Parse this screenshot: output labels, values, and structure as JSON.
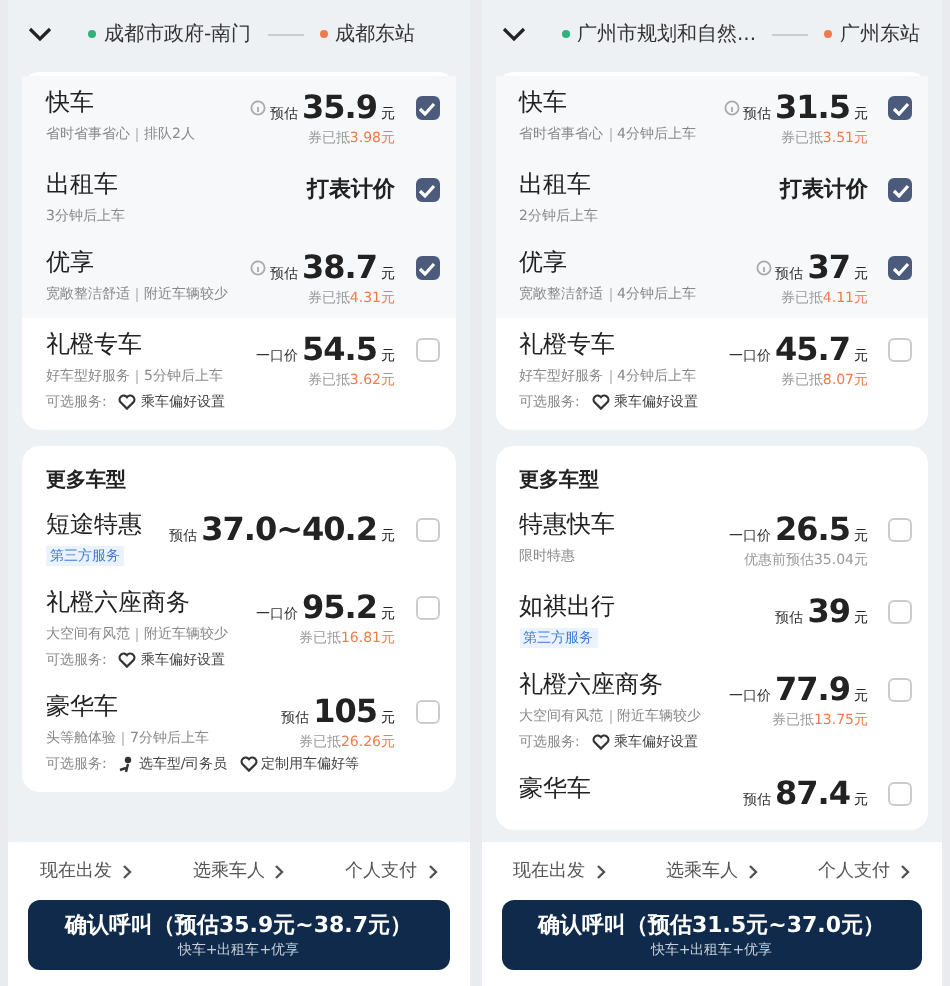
{
  "screens": [
    {
      "from": "成都市政府-南门",
      "to": "成都东站",
      "top_rows": [
        {
          "name": "快车",
          "notes": [
            "省时省事省心",
            "排队2人"
          ],
          "kind": "estimate",
          "prefix": "预估",
          "amount": "35.9",
          "unit": "元",
          "discount": "券已抵",
          "discount_amount": "3.98元",
          "info": true,
          "checked": true
        },
        {
          "name": "出租车",
          "notes": [
            "3分钟后上车"
          ],
          "kind": "meter",
          "meter": "打表计价",
          "checked": true
        },
        {
          "name": "优享",
          "notes": [
            "宽敞整洁舒适",
            "附近车辆较少"
          ],
          "kind": "estimate",
          "prefix": "预估",
          "amount": "38.7",
          "unit": "元",
          "discount": "券已抵",
          "discount_amount": "4.31元",
          "info": true,
          "checked": true
        },
        {
          "name": "礼橙专车",
          "notes": [
            "好车型好服务",
            "5分钟后上车"
          ],
          "kind": "estimate",
          "prefix": "一口价",
          "amount": "54.5",
          "unit": "元",
          "discount": "券已抵",
          "discount_amount": "3.62元",
          "services_label": "可选服务:",
          "services": [
            {
              "kind": "heart",
              "text": "乘车偏好设置"
            }
          ],
          "checked": false
        }
      ],
      "more_title": "更多车型",
      "more_rows": [
        {
          "name": "短途特惠",
          "tag": "第三方服务",
          "kind": "estimate",
          "prefix": "预估",
          "amount": "37.0~40.2",
          "unit": "元",
          "checked": false
        },
        {
          "name": "礼橙六座商务",
          "notes": [
            "大空间有风范",
            "附近车辆较少"
          ],
          "kind": "estimate",
          "prefix": "一口价",
          "amount": "95.2",
          "unit": "元",
          "discount": "券已抵",
          "discount_amount": "16.81元",
          "services_label": "可选服务:",
          "services": [
            {
              "kind": "heart",
              "text": "乘车偏好设置"
            }
          ],
          "checked": false
        },
        {
          "name": "豪华车",
          "notes": [
            "头等舱体验",
            "7分钟后上车"
          ],
          "kind": "estimate",
          "prefix": "预估",
          "amount": "105",
          "unit": "元",
          "discount": "券已抵",
          "discount_amount": "26.26元",
          "services_label": "可选服务:",
          "services": [
            {
              "kind": "person",
              "text": "选车型/司务员"
            },
            {
              "kind": "heart",
              "text": "定制用车偏好等"
            }
          ],
          "checked": false
        }
      ],
      "links": [
        "现在出发",
        "选乘车人",
        "个人支付"
      ],
      "confirm": "确认呼叫（预估35.9元~38.7元）",
      "confirm_sub": "快车+出租车+优享"
    },
    {
      "from": "广州市规划和自然...",
      "to": "广州东站",
      "top_rows": [
        {
          "name": "快车",
          "notes": [
            "省时省事省心",
            "4分钟后上车"
          ],
          "kind": "estimate",
          "prefix": "预估",
          "amount": "31.5",
          "unit": "元",
          "discount": "券已抵",
          "discount_amount": "3.51元",
          "info": true,
          "checked": true
        },
        {
          "name": "出租车",
          "notes": [
            "2分钟后上车"
          ],
          "kind": "meter",
          "meter": "打表计价",
          "checked": true
        },
        {
          "name": "优享",
          "notes": [
            "宽敞整洁舒适",
            "4分钟后上车"
          ],
          "kind": "estimate",
          "prefix": "预估",
          "amount": "37",
          "unit": "元",
          "discount": "券已抵",
          "discount_amount": "4.11元",
          "info": true,
          "checked": true
        },
        {
          "name": "礼橙专车",
          "notes": [
            "好车型好服务",
            "4分钟后上车"
          ],
          "kind": "estimate",
          "prefix": "一口价",
          "amount": "45.7",
          "unit": "元",
          "discount": "券已抵",
          "discount_amount": "8.07元",
          "services_label": "可选服务:",
          "services": [
            {
              "kind": "heart",
              "text": "乘车偏好设置"
            }
          ],
          "checked": false
        }
      ],
      "more_title": "更多车型",
      "more_rows": [
        {
          "name": "特惠快车",
          "notes": [
            "限时特惠"
          ],
          "kind": "estimate",
          "prefix": "一口价",
          "amount": "26.5",
          "unit": "元",
          "discount": "优惠前预估35.04元",
          "checked": false
        },
        {
          "name": "如祺出行",
          "tag": "第三方服务",
          "kind": "estimate",
          "prefix": "预估",
          "amount": "39",
          "unit": "元",
          "checked": false
        },
        {
          "name": "礼橙六座商务",
          "notes": [
            "大空间有风范",
            "附近车辆较少"
          ],
          "kind": "estimate",
          "prefix": "一口价",
          "amount": "77.9",
          "unit": "元",
          "discount": "券已抵",
          "discount_amount": "13.75元",
          "services_label": "可选服务:",
          "services": [
            {
              "kind": "heart",
              "text": "乘车偏好设置"
            }
          ],
          "checked": false
        },
        {
          "name": "豪华车",
          "kind": "estimate",
          "prefix": "预估",
          "amount": "87.4",
          "unit": "元",
          "checked": false
        }
      ],
      "links": [
        "现在出发",
        "选乘车人",
        "个人支付"
      ],
      "confirm": "确认呼叫（预估31.5元~37.0元）",
      "confirm_sub": "快车+出租车+优享"
    }
  ]
}
